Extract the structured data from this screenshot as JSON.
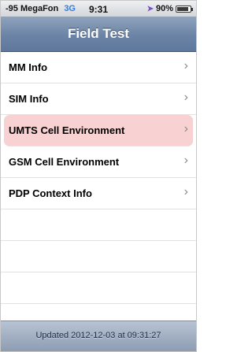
{
  "status_bar": {
    "signal": "-95",
    "carrier": "MegaFon",
    "network": "3G",
    "time": "9:31",
    "battery": "90%",
    "battery_level": 0.9,
    "location_icon": "location-arrow-icon"
  },
  "nav": {
    "title": "Field Test"
  },
  "list": {
    "items": [
      {
        "label": "MM Info"
      },
      {
        "label": "SIM Info"
      },
      {
        "label": "UMTS Cell Environment",
        "selected": true
      },
      {
        "label": "GSM Cell Environment"
      },
      {
        "label": "PDP Context Info"
      }
    ],
    "chevron": "›"
  },
  "footer": {
    "text": "Updated 2012-12-03 at 09:31:27"
  },
  "colors": {
    "highlight": "#f8d1d2",
    "nav": "#6b84a6",
    "network": "#3b7bd6"
  }
}
